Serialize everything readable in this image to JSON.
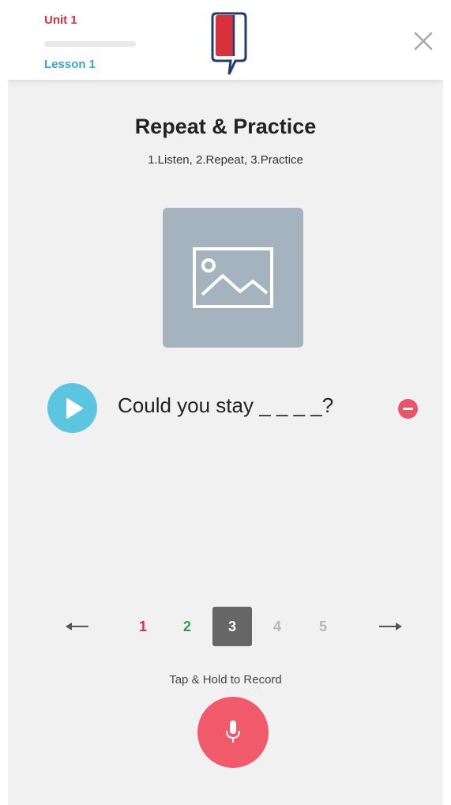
{
  "header": {
    "unit_label": "Unit 1",
    "lesson_label": "Lesson 1",
    "lesson_progress": 0,
    "logo_icon": "speech-bubble-logo-icon",
    "close_icon": "close-icon"
  },
  "activity": {
    "title": "Repeat & Practice",
    "subtitle": "1.Listen, 2.Repeat, 3.Practice",
    "image_icon": "image-placeholder-icon"
  },
  "prompt": {
    "play_icon": "play-icon",
    "sentence": "Could you stay _ _ _ _?",
    "remove_icon": "remove-icon"
  },
  "pagination": {
    "prev_icon": "arrow-left-icon",
    "next_icon": "arrow-right-icon",
    "current": 3,
    "pages": [
      {
        "label": "1",
        "state": "incorrect",
        "color": "#e0303f"
      },
      {
        "label": "2",
        "state": "correct",
        "color": "#2e9e4f"
      },
      {
        "label": "3",
        "state": "current",
        "color": "#ffffff"
      },
      {
        "label": "4",
        "state": "pending",
        "color": "#b8b8b8"
      },
      {
        "label": "5",
        "state": "pending",
        "color": "#b8b8b8"
      }
    ]
  },
  "record": {
    "hint": "Tap & Hold to Record",
    "mic_icon": "microphone-icon"
  },
  "colors": {
    "unit_red": "#e0303f",
    "lesson_blue": "#3aa6c2",
    "play_blue": "#5cc5e0",
    "record_red": "#f05a6b",
    "current_page_bg": "#666666"
  }
}
